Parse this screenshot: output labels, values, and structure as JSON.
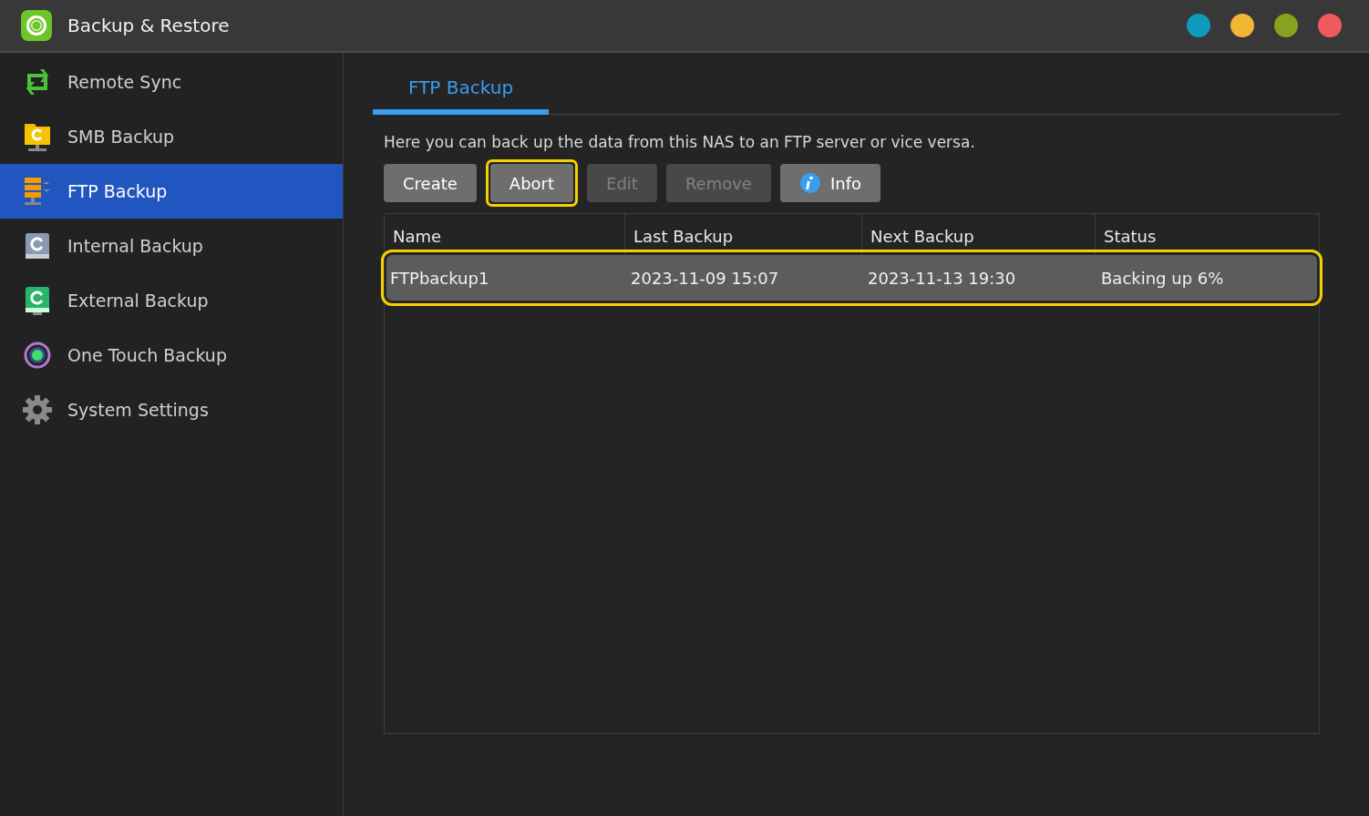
{
  "window": {
    "title": "Backup & Restore",
    "controls": [
      {
        "color": "#0e9bbb"
      },
      {
        "color": "#f2b632"
      },
      {
        "color": "#86a21f"
      },
      {
        "color": "#f05a5f"
      }
    ]
  },
  "sidebar": {
    "items": [
      {
        "label": "Remote Sync",
        "kind": "sync",
        "selected": false
      },
      {
        "label": "SMB Backup",
        "kind": "folder",
        "selected": false
      },
      {
        "label": "FTP Backup",
        "kind": "server",
        "selected": true
      },
      {
        "label": "Internal Backup",
        "kind": "disk",
        "selected": false
      },
      {
        "label": "External Backup",
        "kind": "external",
        "selected": false
      },
      {
        "label": "One Touch Backup",
        "kind": "touch",
        "selected": false
      },
      {
        "label": "System Settings",
        "kind": "gear",
        "selected": false
      }
    ]
  },
  "tabs": [
    {
      "label": "FTP Backup",
      "selected": true
    }
  ],
  "description": "Here you can back up the data from this NAS to an FTP server or vice versa.",
  "buttons": [
    {
      "label": "Create",
      "disabled": false,
      "highlighted": false
    },
    {
      "label": "Abort",
      "disabled": false,
      "highlighted": true
    },
    {
      "label": "Edit",
      "disabled": true,
      "highlighted": false
    },
    {
      "label": "Remove",
      "disabled": true,
      "highlighted": false
    },
    {
      "label": "Info",
      "disabled": false,
      "highlighted": false,
      "kind": "info"
    }
  ],
  "table": {
    "columns": [
      "Name",
      "Last Backup",
      "Next Backup",
      "Status"
    ],
    "rows": [
      {
        "cells": [
          "FTPbackup1",
          "2023-11-09 15:07",
          "2023-11-13 19:30",
          "Backing up 6%"
        ],
        "selected": true,
        "highlighted": true
      }
    ]
  }
}
